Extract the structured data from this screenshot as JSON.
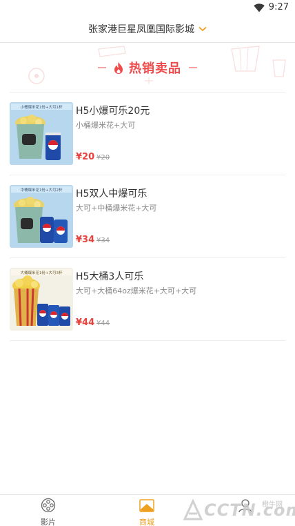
{
  "status_bar": {
    "time": "9:27"
  },
  "header": {
    "cinema_name": "张家港巨星凤凰国际影城"
  },
  "section": {
    "title": "热销卖品"
  },
  "products": [
    {
      "name": "H5小爆可乐20元",
      "desc": "小桶爆米花+大可",
      "price": "¥20",
      "orig_price": "¥20",
      "thumb_caption": "小桶爆米花1份+大可1杯"
    },
    {
      "name": "H5双人中爆可乐",
      "desc": "大可+中桶爆米花+大可",
      "price": "¥34",
      "orig_price": "¥34",
      "thumb_caption": "中桶爆米花1份+大可2杯"
    },
    {
      "name": "H5大桶3人可乐",
      "desc": "大可+大桶64oz爆米花+大可+大可",
      "price": "¥44",
      "orig_price": "¥44",
      "thumb_caption": "大桶爆米花1份+大可3杯"
    }
  ],
  "tabbar": {
    "tabs": [
      {
        "label": "影片",
        "icon": "film-reel-icon"
      },
      {
        "label": "商城",
        "icon": "store-icon",
        "active": true
      },
      {
        "label": "我的",
        "icon": "user-icon"
      }
    ]
  },
  "watermark": {
    "logo": "CCTN.com",
    "small": "橙牛网"
  },
  "colors": {
    "accent": "#f0a020",
    "price": "#e8403b",
    "section_title": "#ef4a4a"
  }
}
